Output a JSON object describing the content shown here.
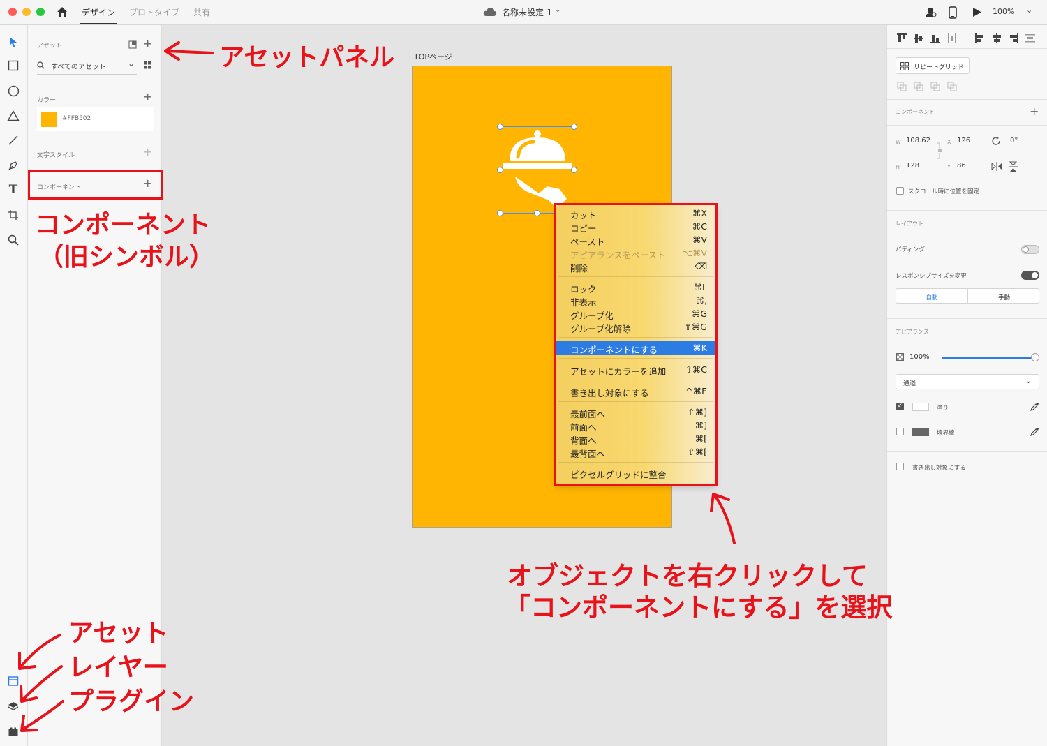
{
  "titlebar": {
    "tabs": [
      "デザイン",
      "プロトタイプ",
      "共有"
    ],
    "doc_title": "名称未設定-1",
    "zoom": "100%"
  },
  "assets": {
    "header": "アセット",
    "search_placeholder": "すべてのアセット",
    "colors_label": "カラー",
    "color_swatch": {
      "hex": "#FFB502",
      "label": "#FFB502"
    },
    "text_styles_label": "文字スタイル",
    "components_label": "コンポーネント"
  },
  "canvas": {
    "artboard_title": "TOPページ",
    "artboard_color": "#FFB502"
  },
  "context_menu": {
    "items": [
      {
        "label": "カット",
        "shortcut": "⌘X",
        "disabled": false
      },
      {
        "label": "コピー",
        "shortcut": "⌘C",
        "disabled": false
      },
      {
        "label": "ペースト",
        "shortcut": "⌘V",
        "disabled": false
      },
      {
        "label": "アピアランスをペースト",
        "shortcut": "⌥⌘V",
        "disabled": true
      },
      {
        "label": "削除",
        "shortcut": "⌫",
        "disabled": false
      },
      {
        "label": "ロック",
        "shortcut": "⌘L",
        "disabled": false
      },
      {
        "label": "非表示",
        "shortcut": "⌘,",
        "disabled": false
      },
      {
        "label": "グループ化",
        "shortcut": "⌘G",
        "disabled": false
      },
      {
        "label": "グループ化解除",
        "shortcut": "⇧⌘G",
        "disabled": false
      },
      {
        "label": "コンポーネントにする",
        "shortcut": "⌘K",
        "disabled": false,
        "highlighted": true
      },
      {
        "label": "アセットにカラーを追加",
        "shortcut": "⇧⌘C",
        "disabled": false
      },
      {
        "label": "書き出し対象にする",
        "shortcut": "^⌘E",
        "disabled": false
      },
      {
        "label": "最前面へ",
        "shortcut": "⇧⌘]",
        "disabled": false
      },
      {
        "label": "前面へ",
        "shortcut": "⌘]",
        "disabled": false
      },
      {
        "label": "背面へ",
        "shortcut": "⌘[",
        "disabled": false
      },
      {
        "label": "最背面へ",
        "shortcut": "⇧⌘[",
        "disabled": false
      },
      {
        "label": "ピクセルグリッドに整合",
        "shortcut": "",
        "disabled": false
      }
    ]
  },
  "properties": {
    "repeat_grid": "リピートグリッド",
    "component_label": "コンポーネント",
    "w_label": "W",
    "w_value": "108.62",
    "x_label": "X",
    "x_value": "126",
    "rotation": "0°",
    "h_label": "H",
    "h_value": "128",
    "y_label": "Y",
    "y_value": "86",
    "fix_scroll": "スクロール時に位置を固定",
    "layout_label": "レイアウト",
    "padding_label": "パディング",
    "padding_on": false,
    "responsive_label": "レスポンシブサイズを変更",
    "responsive_on": true,
    "auto_label": "自動",
    "manual_label": "手動",
    "appearance_label": "アピアランス",
    "opacity": "100%",
    "opacity_fraction": 1.0,
    "blend_mode": "通過",
    "fill_label": "塗り",
    "fill_checked": true,
    "border_label": "境界線",
    "border_checked": false,
    "export_label": "書き出し対象にする"
  },
  "annotations": {
    "asset_panel": "アセットパネル",
    "component_line1": "コンポーネント",
    "component_line2": "（旧シンボル）",
    "right_click_line1": "オブジェクトを右クリックして",
    "right_click_line2": "「コンポーネントにする」を選択",
    "bottom_assets": "アセット",
    "bottom_layers": "レイヤー",
    "bottom_plugins": "プラグイン"
  }
}
